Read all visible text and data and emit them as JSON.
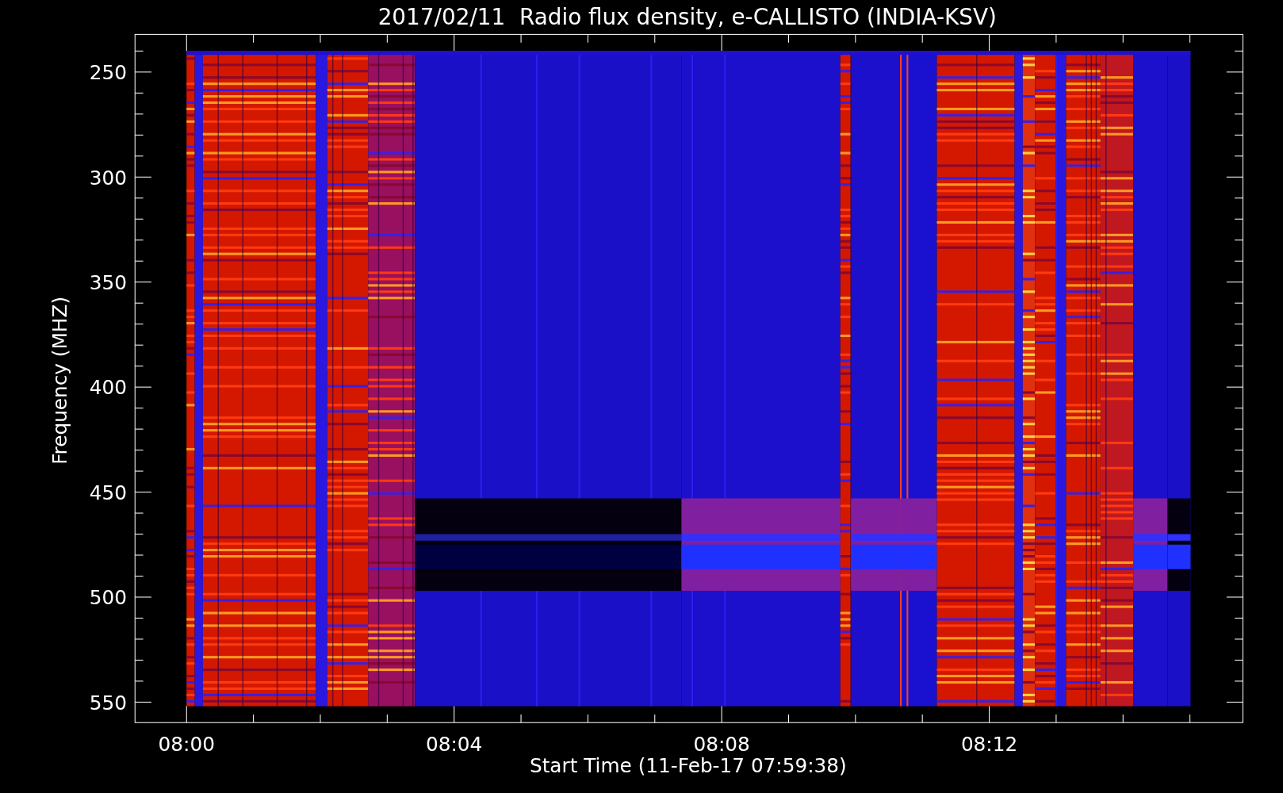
{
  "title": "2017/02/11  Radio flux density, e-CALLISTO (INDIA-KSV)",
  "y_axis": {
    "label": "Frequency (MHZ)",
    "ticks": [
      "250",
      "300",
      "350",
      "400",
      "450",
      "500",
      "550"
    ]
  },
  "x_axis": {
    "label": "Start Time (11-Feb-17 07:59:38)",
    "ticks": [
      "08:00",
      "08:04",
      "08:08",
      "08:12"
    ]
  }
}
